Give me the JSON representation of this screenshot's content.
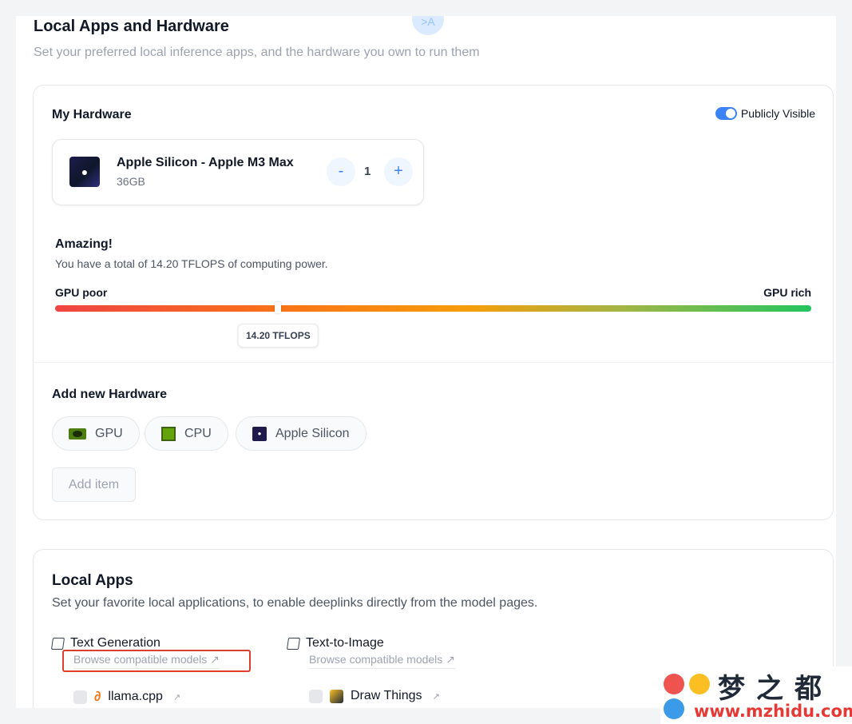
{
  "header": {
    "avatar_text": ">A",
    "title": "Local Apps and Hardware",
    "subtitle": "Set your preferred local inference apps, and the hardware you own to run them"
  },
  "my_hardware": {
    "title": "My Hardware",
    "visibility_label": "Publicly Visible",
    "visibility_on": true,
    "item": {
      "icon": "apple-logo-icon",
      "name": "Apple Silicon - Apple M3 Max",
      "memory": "36GB",
      "decrement_label": "-",
      "quantity": "1",
      "increment_label": "+"
    },
    "rating": "Amazing!",
    "power_text": "You have a total of 14.20 TFLOPS of computing power.",
    "scale_min_label": "GPU poor",
    "scale_max_label": "GPU rich",
    "scale_position": 0.295,
    "tflops_badge": "14.20 TFLOPS",
    "colors": {
      "scale_start": "#ef4444",
      "scale_mid": "#f59e0b",
      "scale_end": "#22c55e",
      "accent": "#3b82f6"
    }
  },
  "add_hardware": {
    "title": "Add new Hardware",
    "types": [
      {
        "label": "GPU",
        "icon": "gpu-card-icon"
      },
      {
        "label": "CPU",
        "icon": "cpu-chip-icon"
      },
      {
        "label": "Apple Silicon",
        "icon": "apple-chip-icon"
      }
    ],
    "add_item_label": "Add item"
  },
  "local_apps": {
    "title": "Local Apps",
    "subtitle": "Set your favorite local applications, to enable deeplinks directly from the model pages.",
    "categories": [
      {
        "label": "Text Generation",
        "browse": "Browse compatible models ↗",
        "apps": [
          {
            "name": "llama.cpp",
            "checked": false
          }
        ]
      },
      {
        "label": "Text-to-Image",
        "browse": "Browse compatible models ↗",
        "apps": [
          {
            "name": "Draw Things",
            "checked": false
          }
        ]
      }
    ],
    "highlight_color": "#dc3f2e"
  },
  "watermark": {
    "brand": "梦之都",
    "url": "www.mzhidu.com"
  }
}
